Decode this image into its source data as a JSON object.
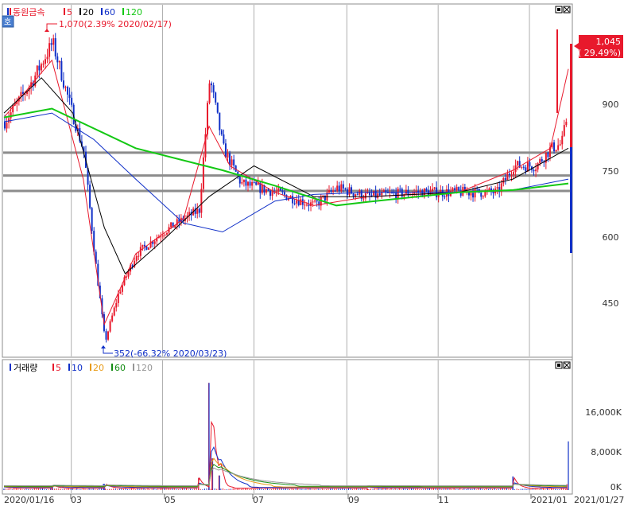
{
  "price_panel": {
    "stock_name": "동원금속",
    "ma_legend": [
      {
        "label": "5",
        "color": "#e8192c"
      },
      {
        "label": "20",
        "color": "#000000"
      },
      {
        "label": "60",
        "color": "#1030c8"
      },
      {
        "label": "120",
        "color": "#14c814"
      }
    ],
    "tab_label": "호",
    "high_annotation": "1,070(2.39% 2020/02/17)",
    "low_annotation": "352(-66.32% 2020/03/23)",
    "current_price": "1,045",
    "current_change": "( 29.49%)",
    "y_ticks": [
      "900",
      "750",
      "600",
      "450"
    ]
  },
  "volume_panel": {
    "label": "거래량",
    "ma_legend": [
      {
        "label": "5",
        "color": "#e8192c"
      },
      {
        "label": "10",
        "color": "#1030c8"
      },
      {
        "label": "20",
        "color": "#e89a14"
      },
      {
        "label": "60",
        "color": "#148c14"
      },
      {
        "label": "120",
        "color": "#969696"
      }
    ],
    "y_ticks": [
      "16,000K",
      "8,000K",
      "0K"
    ]
  },
  "x_axis": {
    "labels": [
      "2020/01/16",
      "03",
      "05",
      "07",
      "09",
      "11",
      "2021/01",
      "2021/01/27"
    ]
  },
  "colors": {
    "up": "#e8192c",
    "down": "#1030c8",
    "hline": "#8c8c8c"
  },
  "chart_data": [
    {
      "type": "candlestick",
      "title": "동원금속",
      "y_ticks": [
        450,
        600,
        750,
        900
      ],
      "ylim": [
        340,
        1120
      ],
      "horizontal_lines": [
        790,
        738,
        703
      ],
      "series": [
        {
          "name": "Price (close)",
          "x": [
            "2020/01/16",
            "2020/02/03",
            "2020/02/17",
            "2020/03/02",
            "2020/03/09",
            "2020/03/16",
            "2020/03/23",
            "2020/04/01",
            "2020/04/13",
            "2020/05/01",
            "2020/05/15",
            "2020/05/25",
            "2020/06/01",
            "2020/06/10",
            "2020/06/22",
            "2020/07/15",
            "2020/08/10",
            "2020/08/25",
            "2020/09/15",
            "2020/10/15",
            "2020/11/15",
            "2020/12/10",
            "2020/12/21",
            "2021/01/05",
            "2021/01/15",
            "2021/01/22",
            "2021/01/26",
            "2021/01/27"
          ],
          "values": [
            860,
            950,
            1040,
            870,
            790,
            560,
            360,
            470,
            560,
            610,
            640,
            660,
            960,
            800,
            720,
            700,
            670,
            710,
            690,
            700,
            700,
            700,
            760,
            760,
            800,
            810,
            880,
            1045
          ]
        },
        {
          "name": "5",
          "x": [
            "2020/01/16",
            "2020/02/17",
            "2020/03/09",
            "2020/03/23",
            "2020/04/13",
            "2020/05/15",
            "2020/06/01",
            "2020/06/15",
            "2020/07/15",
            "2020/08/10",
            "2020/09/15",
            "2020/11/15",
            "2020/12/21",
            "2021/01/15",
            "2021/01/27"
          ],
          "values": [
            870,
            1000,
            730,
            400,
            560,
            640,
            850,
            760,
            700,
            670,
            690,
            700,
            750,
            800,
            980
          ]
        },
        {
          "name": "20",
          "x": [
            "2020/01/16",
            "2020/02/10",
            "2020/03/02",
            "2020/03/23",
            "2020/04/06",
            "2020/05/01",
            "2020/06/01",
            "2020/07/01",
            "2020/08/10",
            "2020/09/15",
            "2020/11/15",
            "2020/12/21",
            "2021/01/27"
          ],
          "values": [
            880,
            960,
            880,
            620,
            515,
            590,
            690,
            760,
            690,
            690,
            700,
            730,
            800
          ]
        },
        {
          "name": "60",
          "x": [
            "2020/01/16",
            "2020/02/17",
            "2020/03/16",
            "2020/04/13",
            "2020/05/15",
            "2020/06/10",
            "2020/07/15",
            "2020/08/10",
            "2020/09/15",
            "2020/11/15",
            "2020/12/21",
            "2021/01/27"
          ],
          "values": [
            860,
            880,
            820,
            730,
            630,
            610,
            680,
            695,
            700,
            700,
            705,
            730
          ]
        },
        {
          "name": "120",
          "x": [
            "2020/01/16",
            "2020/02/17",
            "2020/04/13",
            "2020/06/10",
            "2020/07/15",
            "2020/08/25",
            "2020/09/15",
            "2020/11/15",
            "2020/12/21",
            "2021/01/27"
          ],
          "values": [
            870,
            890,
            800,
            750,
            715,
            670,
            678,
            700,
            705,
            720
          ]
        }
      ],
      "current": {
        "price": 1045,
        "change_pct": 29.49
      },
      "high": {
        "value": 1070,
        "change_pct": 2.39,
        "date": "2020/02/17"
      },
      "low": {
        "value": 352,
        "change_pct": -66.32,
        "date": "2020/03/23"
      }
    },
    {
      "type": "bar",
      "title": "거래량",
      "y_ticks": [
        "0K",
        "8,000K",
        "16,000K"
      ],
      "ylim": [
        0,
        23000
      ],
      "x": [
        "2020/01/16",
        "2020/02/17",
        "2020/03/23",
        "2020/05/25",
        "2020/06/01",
        "2020/06/03",
        "2020/06/08",
        "2020/09/15",
        "2020/12/21",
        "2021/01/26",
        "2021/01/27"
      ],
      "values": [
        300,
        900,
        1300,
        2500,
        22000,
        6500,
        3000,
        300,
        2800,
        1200,
        10000
      ],
      "series_names": [
        "5",
        "10",
        "20",
        "60",
        "120"
      ]
    }
  ]
}
